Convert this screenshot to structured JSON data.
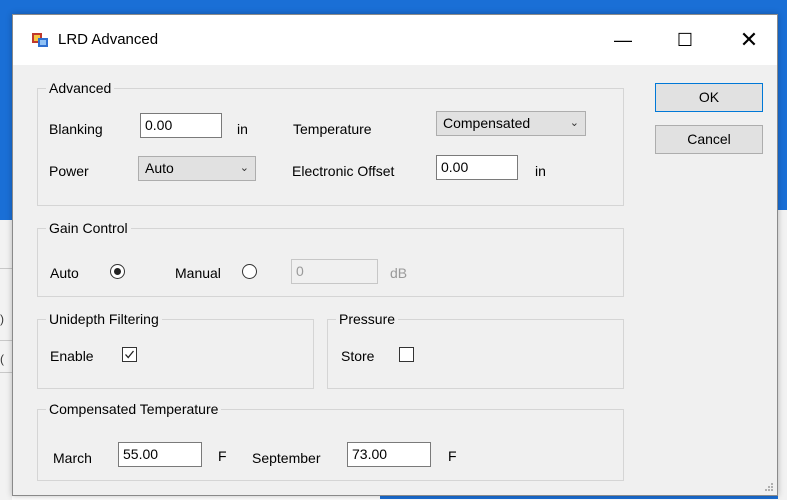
{
  "window": {
    "title": "LRD Advanced",
    "controls": {
      "minimize": "—",
      "maximize": "☐",
      "close": "✕"
    }
  },
  "background": {
    "fragments": [
      ")",
      "(",
      "/"
    ]
  },
  "advanced": {
    "title": "Advanced",
    "blanking_label": "Blanking",
    "blanking_value": "0.00",
    "blanking_unit": "in",
    "temperature_label": "Temperature",
    "temperature_value": "Compensated",
    "power_label": "Power",
    "power_value": "Auto",
    "offset_label": "Electronic Offset",
    "offset_value": "0.00",
    "offset_unit": "in"
  },
  "gain_control": {
    "title": "Gain Control",
    "auto_label": "Auto",
    "auto_selected": true,
    "manual_label": "Manual",
    "manual_selected": false,
    "value": "0",
    "unit": "dB"
  },
  "unidepth": {
    "title": "Unidepth Filtering",
    "enable_label": "Enable",
    "enable_checked": true
  },
  "pressure": {
    "title": "Pressure",
    "store_label": "Store",
    "store_checked": false
  },
  "compensated": {
    "title": "Compensated Temperature",
    "march_label": "March",
    "march_value": "55.00",
    "march_unit": "F",
    "september_label": "September",
    "september_value": "73.00",
    "september_unit": "F"
  },
  "buttons": {
    "ok": "OK",
    "cancel": "Cancel"
  },
  "colors": {
    "accent": "#0078d7",
    "background_window": "#1a6fd6",
    "dialog_bg": "#f0f0f0"
  }
}
